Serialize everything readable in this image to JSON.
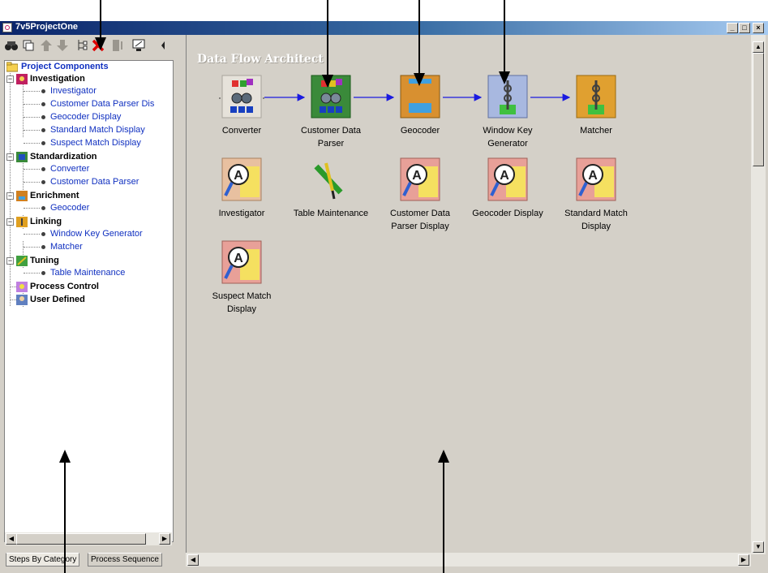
{
  "window": {
    "title": "7v5ProjectOne",
    "controls": [
      "_",
      "□",
      "×"
    ]
  },
  "toolbar": {
    "icons": [
      "binoculars-icon",
      "copy-icon",
      "move-up-icon",
      "move-down-icon",
      "tree-icon",
      "delete-icon",
      "list-icon",
      "monitor-icon"
    ]
  },
  "tree": {
    "root": "Project Components",
    "categories": [
      {
        "label": "Investigation",
        "items": [
          "Investigator",
          "Customer Data Parser Dis",
          "Geocoder Display",
          "Standard Match Display",
          "Suspect Match Display"
        ]
      },
      {
        "label": "Standardization",
        "items": [
          "Converter",
          "Customer Data Parser"
        ]
      },
      {
        "label": "Enrichment",
        "items": [
          "Geocoder"
        ]
      },
      {
        "label": "Linking",
        "items": [
          "Window Key Generator",
          "Matcher"
        ]
      },
      {
        "label": "Tuning",
        "items": [
          "Table Maintenance"
        ]
      },
      {
        "label": "Process Control",
        "items": []
      },
      {
        "label": "User Defined",
        "items": []
      }
    ]
  },
  "tabs": [
    "Steps By Category",
    "Process Sequence"
  ],
  "canvas": {
    "title": "Data Flow Architect",
    "components": [
      {
        "label1": "Converter",
        "label2": "",
        "icon": "converter-icon"
      },
      {
        "label1": "Customer Data",
        "label2": "Parser",
        "icon": "parser-icon"
      },
      {
        "label1": "Geocoder",
        "label2": "",
        "icon": "geocoder-icon"
      },
      {
        "label1": "Window Key",
        "label2": "Generator",
        "icon": "window-key-icon"
      },
      {
        "label1": "Matcher",
        "label2": "",
        "icon": "matcher-icon"
      },
      {
        "label1": "Investigator",
        "label2": "",
        "icon": "investigator-icon"
      },
      {
        "label1": "Table Maintenance",
        "label2": "",
        "icon": "tools-icon"
      },
      {
        "label1": "Customer Data",
        "label2": "Parser Display",
        "icon": "investigator-icon"
      },
      {
        "label1": "Geocoder Display",
        "label2": "",
        "icon": "investigator-icon"
      },
      {
        "label1": "Standard Match",
        "label2": "Display",
        "icon": "investigator-icon"
      },
      {
        "label1": "Suspect Match",
        "label2": "Display",
        "icon": "investigator-icon"
      }
    ]
  },
  "colors": {
    "titlebar": "#0a246a",
    "link": "#1030c0",
    "panel": "#d4d0c8"
  }
}
